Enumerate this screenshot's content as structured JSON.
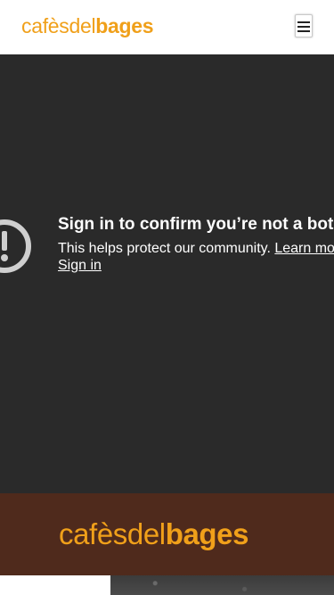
{
  "header": {
    "logo_part1": "cafès",
    "logo_part2": "del",
    "logo_part3": "bages"
  },
  "embed": {
    "title": "Sign in to confirm you’re not a bot",
    "text": "This helps protect our community.",
    "learn_more": "Learn more",
    "sign_in": "Sign in"
  },
  "footer": {
    "logo_part1": "cafès",
    "logo_part2": "del",
    "logo_part3": "bages"
  },
  "colors": {
    "brand_orange": "#f0a01a",
    "brand_brown": "#4f2a1c",
    "embed_bg": "#2a2a2a"
  },
  "icons": {
    "menu": "hamburger-icon",
    "alert": "alert-circle-icon"
  }
}
